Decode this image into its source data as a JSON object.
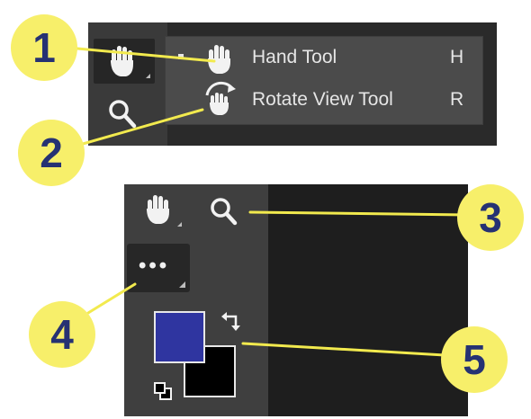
{
  "flyout": {
    "items": [
      {
        "label": "Hand Tool",
        "shortcut": "H",
        "icon": "hand-icon",
        "selected": true
      },
      {
        "label": "Rotate View Tool",
        "shortcut": "R",
        "icon": "rotate-view-icon",
        "selected": false
      }
    ]
  },
  "toolbar_top": {
    "tools": [
      "hand-icon",
      "zoom-icon"
    ]
  },
  "toolbar_bottom": {
    "tools": [
      "hand-icon",
      "zoom-icon"
    ],
    "more_label": "•••",
    "foreground_color": "#2f35a0",
    "background_color": "#000000"
  },
  "callouts": [
    "1",
    "2",
    "3",
    "4",
    "5"
  ],
  "colors": {
    "callout_fill": "#f7ef6a",
    "callout_text": "#263273",
    "leader_line": "#f2ea4e"
  }
}
